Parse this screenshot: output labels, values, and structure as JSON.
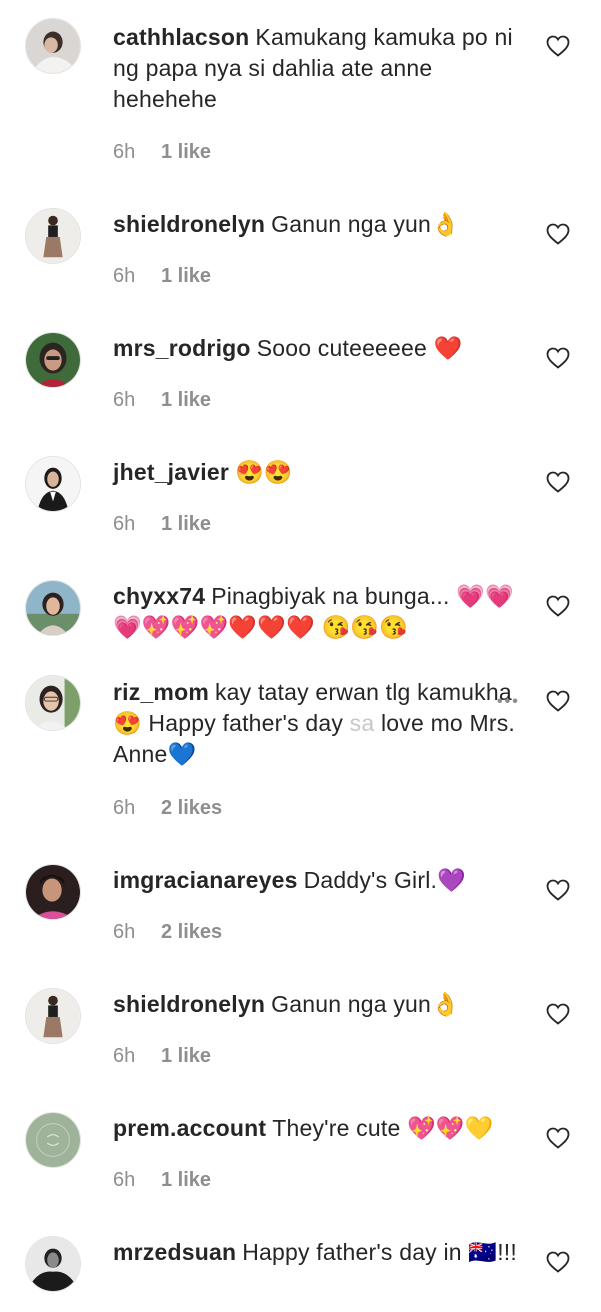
{
  "comments": [
    {
      "username": "cathhlacson",
      "text": "Kamukang kamuka po ni ng papa nya si dahlia ate anne hehehehe",
      "time": "6h",
      "likes": "1 like"
    },
    {
      "username": "shieldronelyn",
      "text": "Ganun nga yun👌",
      "time": "6h",
      "likes": "1 like"
    },
    {
      "username": "mrs_rodrigo",
      "text": "Sooo cuteeeeee ❤️",
      "time": "6h",
      "likes": "1 like"
    },
    {
      "username": "jhet_javier",
      "text": "😍😍",
      "time": "6h",
      "likes": "1 like"
    },
    {
      "username": "chyxx74",
      "text": "Pinagbiyak na bunga... 💗💗💗💖💖💖❤️❤️❤️ 😘😘😘",
      "time": "",
      "likes": ""
    },
    {
      "username": "riz_mom",
      "text": "kay tatay erwan tlg kamukha😍   Happy father's day",
      "text_faded": " sa",
      "text_end": " love mo Mrs. Anne💙",
      "more": "•••",
      "time": "6h",
      "likes": "2 likes"
    },
    {
      "username": "imgracianareyes",
      "text": "Daddy's Girl.💜",
      "time": "6h",
      "likes": "2 likes"
    },
    {
      "username": "shieldronelyn",
      "text": "Ganun nga yun👌",
      "time": "6h",
      "likes": "1 like"
    },
    {
      "username": "prem.account",
      "text": "They're cute 💖💖💛",
      "time": "6h",
      "likes": "1 like"
    },
    {
      "username": "mrzedsuan",
      "text": "Happy father's day in 🇦🇺!!!",
      "time": "",
      "likes": ""
    }
  ],
  "colors": {
    "text": "#262626",
    "meta": "#8e8e8e",
    "heart_stroke": "#262626"
  }
}
